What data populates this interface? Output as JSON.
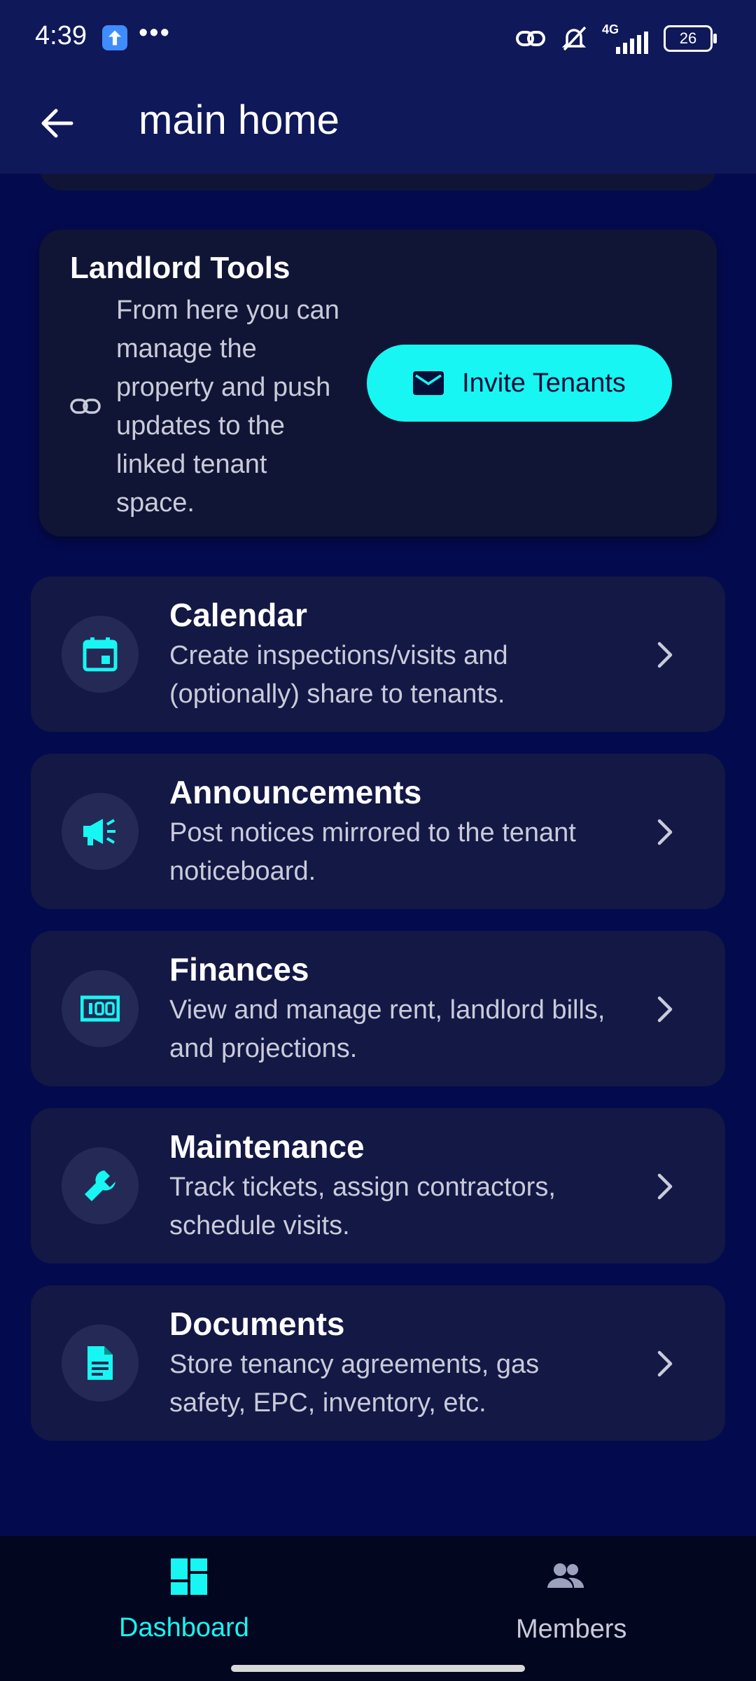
{
  "status_bar": {
    "time": "4:39",
    "more_dots": "•••",
    "network": "4G",
    "battery": "26"
  },
  "app_bar": {
    "title": "main home"
  },
  "landlord_tools": {
    "title": "Landlord Tools",
    "description": "From here you can manage the property and push updates to the linked tenant space.",
    "invite_label": "Invite Tenants"
  },
  "menu": [
    {
      "title": "Calendar",
      "description": "Create inspections/visits and (optionally) share to tenants.",
      "icon": "calendar-icon"
    },
    {
      "title": "Announcements",
      "description": "Post notices mirrored to the tenant noticeboard.",
      "icon": "megaphone-icon"
    },
    {
      "title": "Finances",
      "description": "View and manage rent, landlord bills, and projections.",
      "icon": "money-icon"
    },
    {
      "title": "Maintenance",
      "description": "Track tickets, assign contractors, schedule visits.",
      "icon": "wrench-icon"
    },
    {
      "title": "Documents",
      "description": "Store tenancy agreements, gas safety, EPC, inventory, etc.",
      "icon": "document-icon"
    }
  ],
  "bottom_nav": {
    "dashboard_label": "Dashboard",
    "members_label": "Members",
    "active": "Dashboard"
  },
  "colors": {
    "background": "#040a4e",
    "app_bar": "#0f1858",
    "accent": "#17f6f2",
    "card": "#131845",
    "text_secondary": "#c9cbd9"
  }
}
